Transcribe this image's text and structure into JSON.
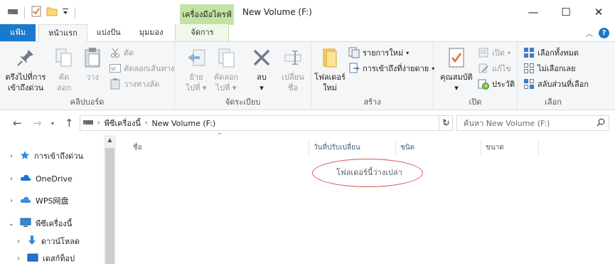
{
  "window": {
    "title": "New Volume (F:)",
    "context_group": "เครื่องมือไดรฟ์",
    "minimize": "—",
    "maximize": "☐",
    "close": "✕"
  },
  "tabs": [
    {
      "label": "แฟ้ม"
    },
    {
      "label": "หน้าแรก"
    },
    {
      "label": "แบ่งปัน"
    },
    {
      "label": "มุมมอง"
    },
    {
      "label": "จัดการ"
    }
  ],
  "ribbon": {
    "clipboard": {
      "label": "คลิปบอร์ด",
      "pin_l1": "ตรึงไปที่การ",
      "pin_l2": "เข้าถึงด่วน",
      "copy_l1": "คัด",
      "copy_l2": "ลอก",
      "paste": "วาง",
      "cut": "ตัด",
      "copy_path": "คัดลอกเส้นทาง",
      "paste_shortcut": "วางทางลัด"
    },
    "organize": {
      "label": "จัดระเบียบ",
      "move_l1": "ย้าย",
      "move_l2": "ไปที่",
      "copyto_l1": "คัดลอก",
      "copyto_l2": "ไปที่",
      "delete": "ลบ",
      "rename_l1": "เปลี่ยน",
      "rename_l2": "ชื่อ"
    },
    "new": {
      "label": "สร้าง",
      "folder_l1": "โฟลเดอร์",
      "folder_l2": "ใหม่",
      "new_item": "รายการใหม่",
      "easy_access": "การเข้าถึงที่ง่ายดาย"
    },
    "open": {
      "label": "เปิด",
      "properties": "คุณสมบัติ",
      "open": "เปิด",
      "edit": "แก้ไข",
      "history": "ประวัติ"
    },
    "select": {
      "label": "เลือก",
      "select_all": "เลือกทั้งหมด",
      "select_none": "ไม่เลือกเลย",
      "invert": "สลับส่วนที่เลือก"
    }
  },
  "address": {
    "crumbs": [
      "พีซีเครื่องนี้",
      "New Volume (F:)"
    ],
    "search_placeholder": "ค้นหา New Volume (F:)"
  },
  "nav": {
    "items": [
      {
        "label": "การเข้าถึงด่วน",
        "icon": "star-icon"
      },
      {
        "label": "OneDrive",
        "icon": "cloud-icon"
      },
      {
        "label": "WPS网盘",
        "icon": "cloud-icon"
      },
      {
        "label": "พีซีเครื่องนี้",
        "icon": "computer-icon"
      },
      {
        "label": "ดาวน์โหลด",
        "icon": "download-icon"
      },
      {
        "label": "เดสก์ท็อป",
        "icon": "desktop-icon"
      }
    ]
  },
  "filelist": {
    "columns": [
      "ชื่อ",
      "วันที่ปรับเปลี่ยน",
      "ชนิด",
      "ขนาด"
    ],
    "empty_message": "โฟลเดอร์นี้ว่างเปล่า"
  },
  "colors": {
    "file_tab": "#1979ca",
    "context_tab": "#c3e3a4",
    "annotation": "#d9534f"
  }
}
